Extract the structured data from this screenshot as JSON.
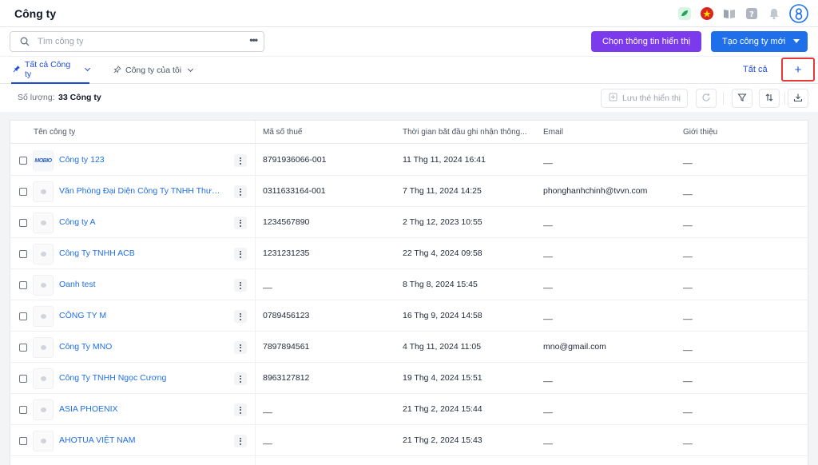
{
  "header": {
    "title": "Công ty"
  },
  "search": {
    "placeholder": "Tìm công ty",
    "more": "•••"
  },
  "actions": {
    "choose_display": "Chọn thông tin hiển thị",
    "create_company": "Tạo công ty mới"
  },
  "tabs": [
    {
      "label": "Tất cả Công ty",
      "active": true
    },
    {
      "label": "Công ty của tôi",
      "active": false
    }
  ],
  "views": {
    "all_label": "Tất cả",
    "add_symbol": "+"
  },
  "summary": {
    "count_label": "Số lượng:",
    "count_value": "33 Công ty"
  },
  "toolbar": {
    "save_view": "Lưu thẻ hiển thị"
  },
  "table": {
    "columns": [
      "Tên công ty",
      "Mã số thuế",
      "Thời gian bắt đầu ghi nhận thông...",
      "Email",
      "Giới thiệu"
    ],
    "rows": [
      {
        "name": "Công ty 123",
        "tax": "8791936066-001",
        "time": "11 Thg 11, 2024 16:41",
        "email": "__",
        "intro": "__",
        "logo": "MOBIO"
      },
      {
        "name": "Văn Phòng Đại Diện Công Ty TNHH Thương Mại",
        "tax": "0311633164-001",
        "time": "7 Thg 11, 2024 14:25",
        "email": "phonghanhchinh@tvvn.com",
        "intro": "__"
      },
      {
        "name": "Công ty A",
        "tax": "1234567890",
        "time": "2 Thg 12, 2023 10:55",
        "email": "__",
        "intro": "__"
      },
      {
        "name": "Công Ty TNHH ACB",
        "tax": "1231231235",
        "time": "22 Thg 4, 2024 09:58",
        "email": "__",
        "intro": "__"
      },
      {
        "name": "Oanh test",
        "tax": "__",
        "time": "8 Thg 8, 2024 15:45",
        "email": "__",
        "intro": "__"
      },
      {
        "name": "CÔNG TY M",
        "tax": "0789456123",
        "time": "16 Thg 9, 2024 14:58",
        "email": "__",
        "intro": "__"
      },
      {
        "name": "Công Ty MNO",
        "tax": "7897894561",
        "time": "4 Thg 11, 2024 11:05",
        "email": "mno@gmail.com",
        "intro": "__"
      },
      {
        "name": "Công Ty TNHH Ngọc Cương",
        "tax": "8963127812",
        "time": "19 Thg 4, 2024 15:51",
        "email": "__",
        "intro": "__"
      },
      {
        "name": "ASIA PHOENIX",
        "tax": "__",
        "time": "21 Thg 2, 2024 15:44",
        "email": "__",
        "intro": "__"
      },
      {
        "name": "AHOTUA VIỆT NAM",
        "tax": "__",
        "time": "21 Thg 2, 2024 15:43",
        "email": "__",
        "intro": "__"
      }
    ]
  },
  "colors": {
    "primary": "#1f6feb",
    "purple": "#7c3aed",
    "highlight": "#e53935"
  },
  "icons": [
    "search-icon",
    "more-icon",
    "pin-icon",
    "chevron-down-icon",
    "plus-icon",
    "bookmark-icon",
    "refresh-icon",
    "filter-icon",
    "sort-icon",
    "download-icon",
    "leaf-icon",
    "flag-vn-icon",
    "book-icon",
    "help-icon",
    "bell-icon",
    "avatar-icon",
    "kebab-icon"
  ]
}
